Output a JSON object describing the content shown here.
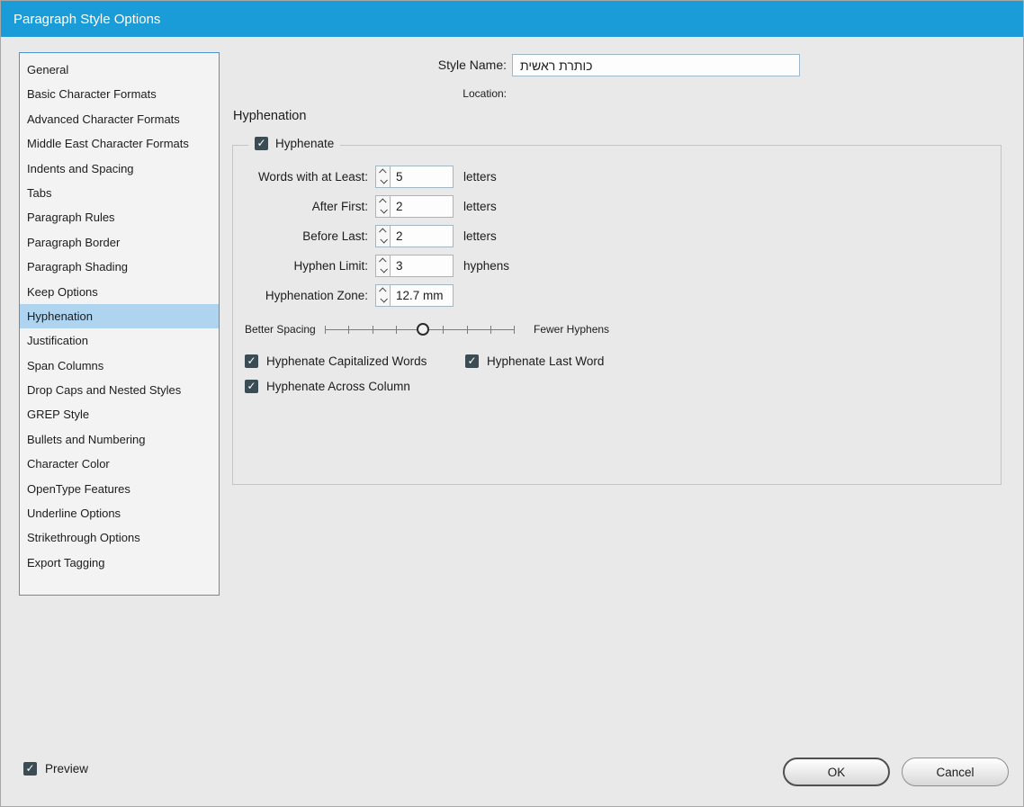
{
  "window": {
    "title": "Paragraph Style Options"
  },
  "sidebar": {
    "items": [
      {
        "label": "General",
        "selected": false
      },
      {
        "label": "Basic Character Formats",
        "selected": false
      },
      {
        "label": "Advanced Character Formats",
        "selected": false
      },
      {
        "label": "Middle East Character Formats",
        "selected": false
      },
      {
        "label": "Indents and Spacing",
        "selected": false
      },
      {
        "label": "Tabs",
        "selected": false
      },
      {
        "label": "Paragraph Rules",
        "selected": false
      },
      {
        "label": "Paragraph Border",
        "selected": false
      },
      {
        "label": "Paragraph Shading",
        "selected": false
      },
      {
        "label": "Keep Options",
        "selected": false
      },
      {
        "label": "Hyphenation",
        "selected": true
      },
      {
        "label": "Justification",
        "selected": false
      },
      {
        "label": "Span Columns",
        "selected": false
      },
      {
        "label": "Drop Caps and Nested Styles",
        "selected": false
      },
      {
        "label": "GREP Style",
        "selected": false
      },
      {
        "label": "Bullets and Numbering",
        "selected": false
      },
      {
        "label": "Character Color",
        "selected": false
      },
      {
        "label": "OpenType Features",
        "selected": false
      },
      {
        "label": "Underline Options",
        "selected": false
      },
      {
        "label": "Strikethrough Options",
        "selected": false
      },
      {
        "label": "Export Tagging",
        "selected": false
      }
    ]
  },
  "header": {
    "style_name_label": "Style Name:",
    "style_name_value": "כותרת ראשית",
    "location_label": "Location:"
  },
  "panel": {
    "title": "Hyphenation",
    "hyphenate_label": "Hyphenate",
    "hyphenate_checked": true,
    "fields": [
      {
        "label": "Words with at Least:",
        "value": "5",
        "unit": "letters"
      },
      {
        "label": "After First:",
        "value": "2",
        "unit": "letters"
      },
      {
        "label": "Before Last:",
        "value": "2",
        "unit": "letters"
      },
      {
        "label": "Hyphen Limit:",
        "value": "3",
        "unit": "hyphens"
      },
      {
        "label": "Hyphenation Zone:",
        "value": "12.7 mm",
        "unit": ""
      }
    ],
    "slider": {
      "left_label": "Better Spacing",
      "right_label": "Fewer Hyphens",
      "position_percent": 52
    },
    "checkboxes": [
      {
        "label": "Hyphenate Capitalized Words",
        "checked": true
      },
      {
        "label": "Hyphenate Last Word",
        "checked": true
      },
      {
        "label": "Hyphenate Across Column",
        "checked": true
      }
    ]
  },
  "footer": {
    "preview_label": "Preview",
    "preview_checked": true,
    "ok_label": "OK",
    "cancel_label": "Cancel"
  },
  "colors": {
    "titlebar": "#1a9cd8",
    "sidebar_selection": "#aed4f0",
    "checkbox_fill": "#3c4c54"
  }
}
